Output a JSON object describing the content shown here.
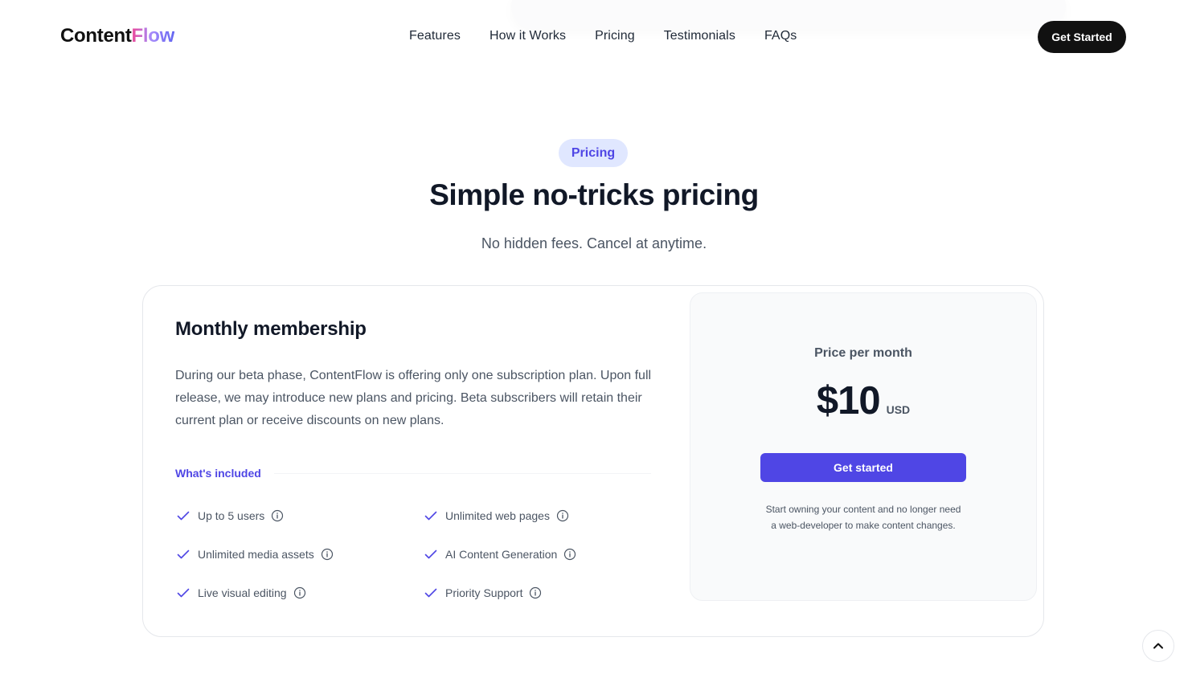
{
  "header": {
    "logo": {
      "part1": "Content",
      "part2": "Flow"
    },
    "nav": [
      {
        "label": "Features"
      },
      {
        "label": "How it Works"
      },
      {
        "label": "Pricing"
      },
      {
        "label": "Testimonials"
      },
      {
        "label": "FAQs"
      }
    ],
    "cta_label": "Get Started"
  },
  "hero": {
    "badge": "Pricing",
    "title": "Simple no-tricks pricing",
    "subtitle": "No hidden fees. Cancel at anytime."
  },
  "plan": {
    "title": "Monthly membership",
    "description": "During our beta phase, ContentFlow is offering only one subscription plan. Upon full release, we may introduce new plans and pricing. Beta subscribers will retain their current plan or receive discounts on new plans.",
    "included_label": "What's included",
    "features": [
      {
        "label": "Up to 5 users",
        "icon": "check-icon",
        "info_icon": "info-icon"
      },
      {
        "label": "Unlimited web pages",
        "icon": "check-icon",
        "info_icon": "info-icon"
      },
      {
        "label": "Unlimited media assets",
        "icon": "check-icon",
        "info_icon": "info-icon"
      },
      {
        "label": "AI Content Generation",
        "icon": "check-icon",
        "info_icon": "info-icon"
      },
      {
        "label": "Live visual editing",
        "icon": "check-icon",
        "info_icon": "info-icon"
      },
      {
        "label": "Priority Support",
        "icon": "check-icon",
        "info_icon": "info-icon"
      }
    ]
  },
  "price": {
    "label": "Price per month",
    "amount": "$10",
    "currency": "USD",
    "button_label": "Get started",
    "note": "Start owning your content and no longer need a web-developer to make content changes."
  },
  "scroll_top": {
    "icon": "chevron-up-icon"
  },
  "colors": {
    "accent": "#4f46e5",
    "badge_bg": "#e0e7ff",
    "dark": "#111111",
    "text_muted": "#4b5563",
    "panel_bg": "#f9fafb"
  }
}
